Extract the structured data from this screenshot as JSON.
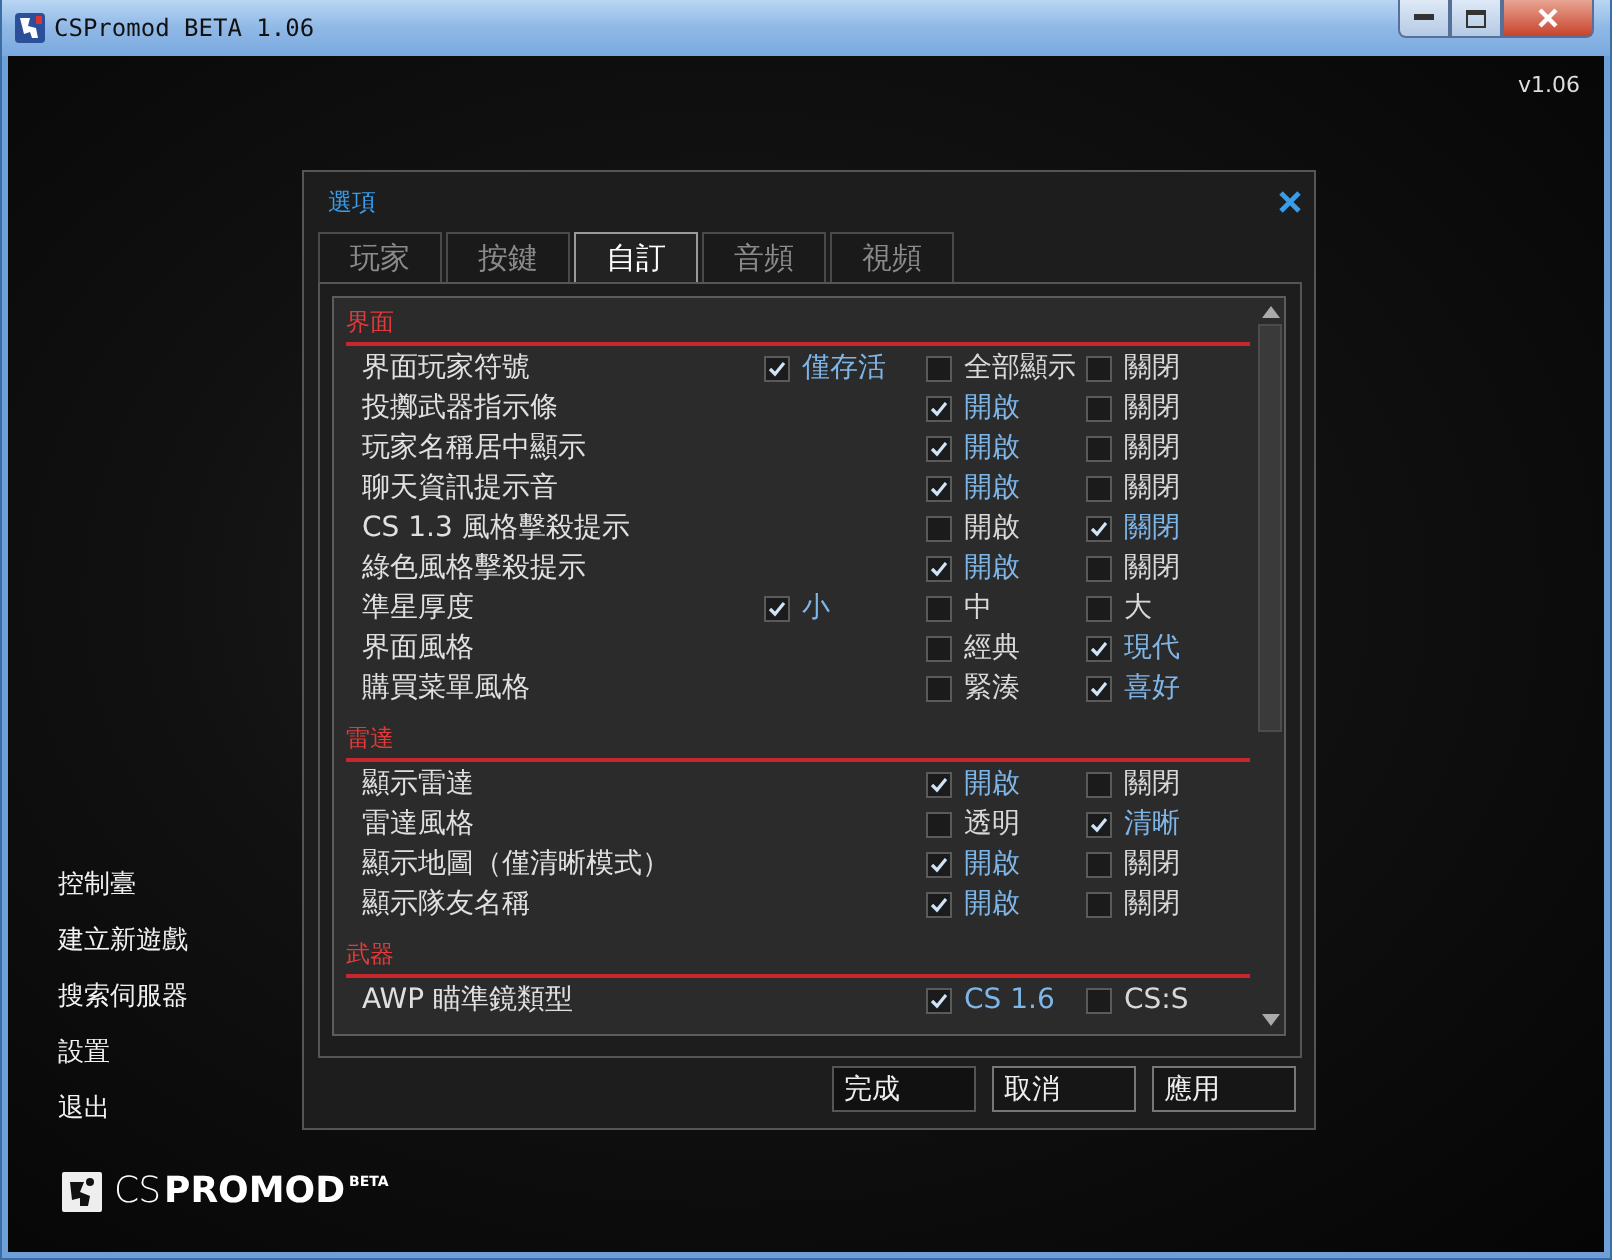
{
  "window": {
    "title": "CSPromod BETA 1.06"
  },
  "version": "v1.06",
  "dialog": {
    "title": "選項",
    "tabs": [
      {
        "label": "玩家",
        "selected": false
      },
      {
        "label": "按鍵",
        "selected": false
      },
      {
        "label": "自訂",
        "selected": true
      },
      {
        "label": "音頻",
        "selected": false
      },
      {
        "label": "視頻",
        "selected": false
      }
    ],
    "sections": [
      {
        "title": "界面",
        "rows": [
          {
            "label": "界面玩家符號",
            "kind": "three",
            "options": [
              {
                "label": "僅存活",
                "selected": true
              },
              {
                "label": "全部顯示",
                "selected": false
              },
              {
                "label": "關閉",
                "selected": false
              }
            ]
          },
          {
            "label": "投擲武器指示條",
            "kind": "two",
            "options": [
              {
                "label": "開啟",
                "selected": true
              },
              {
                "label": "關閉",
                "selected": false
              }
            ]
          },
          {
            "label": "玩家名稱居中顯示",
            "kind": "two",
            "options": [
              {
                "label": "開啟",
                "selected": true
              },
              {
                "label": "關閉",
                "selected": false
              }
            ]
          },
          {
            "label": "聊天資訊提示音",
            "kind": "two",
            "options": [
              {
                "label": "開啟",
                "selected": true
              },
              {
                "label": "關閉",
                "selected": false
              }
            ]
          },
          {
            "label": "CS 1.3 風格擊殺提示",
            "kind": "two",
            "options": [
              {
                "label": "開啟",
                "selected": false
              },
              {
                "label": "關閉",
                "selected": true
              }
            ]
          },
          {
            "label": "綠色風格擊殺提示",
            "kind": "two",
            "options": [
              {
                "label": "開啟",
                "selected": true
              },
              {
                "label": "關閉",
                "selected": false
              }
            ]
          },
          {
            "label": "準星厚度",
            "kind": "three",
            "options": [
              {
                "label": "小",
                "selected": true
              },
              {
                "label": "中",
                "selected": false
              },
              {
                "label": "大",
                "selected": false
              }
            ]
          },
          {
            "label": "界面風格",
            "kind": "two",
            "options": [
              {
                "label": "經典",
                "selected": false
              },
              {
                "label": "現代",
                "selected": true
              }
            ]
          },
          {
            "label": "購買菜單風格",
            "kind": "two",
            "options": [
              {
                "label": "緊湊",
                "selected": false
              },
              {
                "label": "喜好",
                "selected": true
              }
            ]
          }
        ]
      },
      {
        "title": "雷達",
        "rows": [
          {
            "label": "顯示雷達",
            "kind": "two",
            "options": [
              {
                "label": "開啟",
                "selected": true
              },
              {
                "label": "關閉",
                "selected": false
              }
            ]
          },
          {
            "label": "雷達風格",
            "kind": "two",
            "options": [
              {
                "label": "透明",
                "selected": false
              },
              {
                "label": "清晰",
                "selected": true
              }
            ]
          },
          {
            "label": "顯示地圖（僅清晰模式）",
            "kind": "two",
            "options": [
              {
                "label": "開啟",
                "selected": true
              },
              {
                "label": "關閉",
                "selected": false
              }
            ]
          },
          {
            "label": "顯示隊友名稱",
            "kind": "two",
            "options": [
              {
                "label": "開啟",
                "selected": true
              },
              {
                "label": "關閉",
                "selected": false
              }
            ]
          }
        ]
      },
      {
        "title": "武器",
        "rows": [
          {
            "label": "AWP 瞄準鏡類型",
            "kind": "two",
            "options": [
              {
                "label": "CS 1.6",
                "selected": true
              },
              {
                "label": "CS:S",
                "selected": false
              }
            ]
          }
        ]
      }
    ],
    "buttons": [
      "完成",
      "取消",
      "應用"
    ]
  },
  "menu": [
    "控制臺",
    "建立新遊戲",
    "搜索伺服器",
    "設置",
    "退出"
  ],
  "logo": {
    "prefix": "CS",
    "name": "PROMOD",
    "badge": "BETA"
  }
}
